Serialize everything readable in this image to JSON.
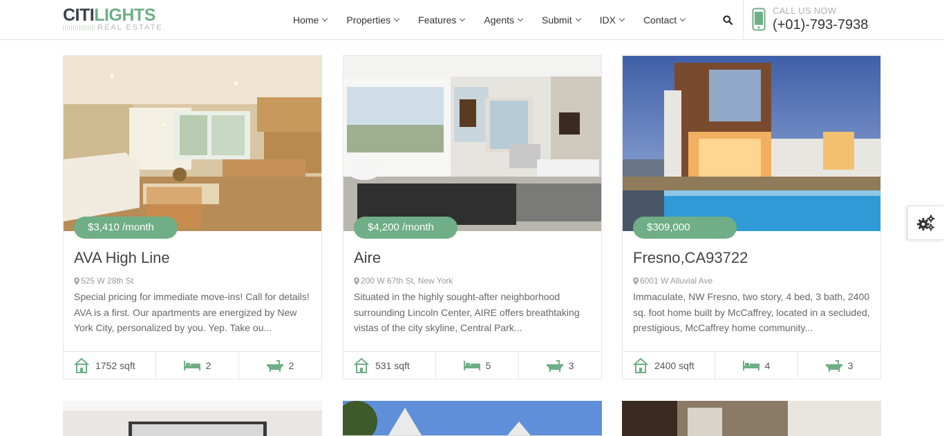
{
  "header": {
    "logo_main_1": "CITI",
    "logo_main_2": "LIGHTS",
    "logo_sub": "REAL ESTATE",
    "nav": [
      "Home",
      "Properties",
      "Features",
      "Agents",
      "Submit",
      "IDX",
      "Contact"
    ],
    "call_label": "CALL US NOW",
    "call_number": "(+01)-793-7938"
  },
  "colors": {
    "accent": "#6fae86",
    "text": "#333333"
  },
  "listings": [
    {
      "price": "$3,410 /month",
      "title": "AVA High Line",
      "address": "525 W 28th St",
      "description": "Special pricing for immediate move-ins! Call for details! AVA is a first. Our apartments are energized by New York City, personalized by you. Yep. Take ou...",
      "area": "1752 sqft",
      "beds": "2",
      "baths": "2"
    },
    {
      "price": "$4,200 /month",
      "title": "Aire",
      "address": "200 W 67th St, New York",
      "description": "Situated in the highly sought-after neighborhood surrounding Lincoln Center, AIRE offers breathtaking vistas of the city skyline, Central Park...",
      "area": "531 sqft",
      "beds": "5",
      "baths": "3"
    },
    {
      "price": "$309,000",
      "title": "Fresno,CA93722",
      "address": "6001 W Alluvial Ave",
      "description": "Immaculate, NW Fresno, two story, 4 bed, 3 bath, 2400 sq. foot home built by McCaffrey, located in a secluded, prestigious, McCaffrey home community...",
      "area": "2400 sqft",
      "beds": "4",
      "baths": "3"
    }
  ]
}
